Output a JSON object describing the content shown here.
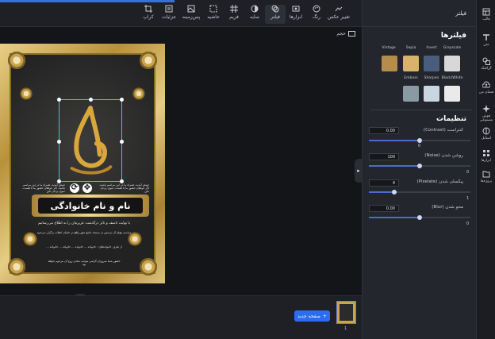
{
  "toolbar": {
    "tools": [
      {
        "label": "تغییر عکس",
        "icon": "image-swap-icon"
      },
      {
        "label": "رنگ",
        "icon": "palette-icon"
      },
      {
        "label": "ابزارها",
        "icon": "tools-icon"
      },
      {
        "label": "فیلتر",
        "icon": "filter-icon"
      },
      {
        "label": "سایه",
        "icon": "shadow-icon"
      },
      {
        "label": "فریم",
        "icon": "frame-icon"
      },
      {
        "label": "حاشیه",
        "icon": "border-icon"
      },
      {
        "label": "پس‌زمینه",
        "icon": "background-icon"
      },
      {
        "label": "جزئیات",
        "icon": "details-icon"
      },
      {
        "label": "کراپ",
        "icon": "crop-icon"
      }
    ],
    "active_tool": "فیلتر"
  },
  "canvas": {
    "size_label": "حجم",
    "poster": {
      "headline": "نام و نام خانوادگی",
      "intro_text": "خوش آمدید. همراه ما در این مراسم باشید. اگر خواهان حضور ما تا هست، سوی یزدان بکن",
      "subtitle": "با نهایت تاسف و تاثر درگذشت عزیزمان را به اطلاع می‌رسانیم",
      "ceremony_text": "مراسم چهلم آن مرحوم در مسجد جامع شهر واقع در خیابان انقلاب برگزار می‌شود",
      "families": "از طرف خانواده‌های : خانواده ... خانواده ... خانواده ... خانواده ...",
      "footer_text": "حضور شما سروران گرامی موجب شادی روح آن مرحوم خواهد بود"
    }
  },
  "bottom": {
    "new_page_label": "صفحه جدید",
    "page_number": "1"
  },
  "panel": {
    "header_title": "فیلتر",
    "filters_title": "فیلترها",
    "filters": [
      {
        "label": "Grayscale",
        "color": "#d8d8d8"
      },
      {
        "label": "Invert",
        "color": "#5a6f8f"
      },
      {
        "label": "Sepia",
        "color": "#d9b36a"
      },
      {
        "label": "Vintage",
        "color": "#b68c4a"
      },
      {
        "label": "Black/White",
        "color": "#eaeaea"
      },
      {
        "label": "Sharpen",
        "color": "#c9d6e2"
      },
      {
        "label": "Emboss",
        "color": "#8a9aa4"
      }
    ],
    "settings_title": "تنظیمات",
    "settings": [
      {
        "label": "کنتراست (Contrast)",
        "input": "0.00",
        "value": "0",
        "fraction": 0.5
      },
      {
        "label": "روشن شدن (Noise)",
        "input": "100",
        "value": "0",
        "fraction": 0.5
      },
      {
        "label": "پیکسلی شدن (Pixelate)",
        "input": "4",
        "value": "1",
        "fraction": 0.25
      },
      {
        "label": "محو شدن (Blur)",
        "input": "0.00",
        "value": "0",
        "fraction": 0.5
      }
    ]
  },
  "rail": {
    "items": [
      {
        "label": "قالب",
        "icon": "template-icon"
      },
      {
        "label": "متن",
        "icon": "text-icon"
      },
      {
        "label": "گرافیک",
        "icon": "graphic-icon"
      },
      {
        "label": "فضای من",
        "icon": "cloud-upload-icon"
      },
      {
        "label": "هوش مصنوعی",
        "icon": "ai-icon"
      },
      {
        "label": "استایل",
        "icon": "style-icon"
      },
      {
        "label": "ابزارها",
        "icon": "tools-icon"
      },
      {
        "label": "پروژه‌ها",
        "icon": "projects-icon"
      }
    ]
  },
  "colors": {
    "accent": "#2c6cf0",
    "selection": "#2fd2c7",
    "gold": "#c9a84c",
    "panel_bg": "#23262c"
  }
}
